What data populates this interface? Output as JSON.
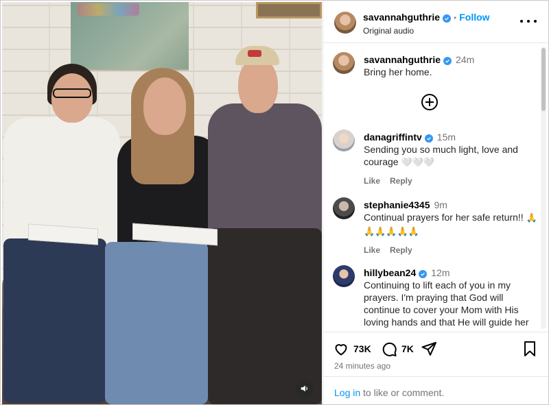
{
  "post": {
    "author": "savannahguthrie",
    "verified": true,
    "follow_label": "Follow",
    "dot": "•",
    "audio": "Original audio",
    "caption_time": "24m",
    "caption": "Bring her home."
  },
  "comments": [
    {
      "user": "danagriffintv",
      "verified": true,
      "time": "15m",
      "text": "Sending you so much light, love and courage",
      "emoji": "🤍🤍🤍",
      "like_label": "Like",
      "reply_label": "Reply"
    },
    {
      "user": "stephanie4345",
      "verified": false,
      "time": "9m",
      "text": "Continual prayers for her safe return!!",
      "emoji": "🙏🙏🙏🙏🙏🙏",
      "like_label": "Like",
      "reply_label": "Reply"
    },
    {
      "user": "hillybean24",
      "verified": true,
      "time": "12m",
      "text": "Continuing to lift each of you in my prayers. I'm praying that God will continue to cover your Mom with His loving hands and that He will guide her back to you all. So much love"
    }
  ],
  "stats": {
    "likes": "73K",
    "comments": "7K",
    "time_ago": "24 minutes ago"
  },
  "footer": {
    "login_link": "Log in",
    "login_text": " to like or comment."
  },
  "colors": {
    "accent": "#0095f6",
    "verified_badge": "#3897f0",
    "muted": "#737373"
  },
  "icons": [
    "heart-icon",
    "comment-icon",
    "share-icon",
    "bookmark-icon",
    "more-options-icon",
    "add-comment-icon",
    "volume-icon",
    "verified-badge-icon"
  ]
}
